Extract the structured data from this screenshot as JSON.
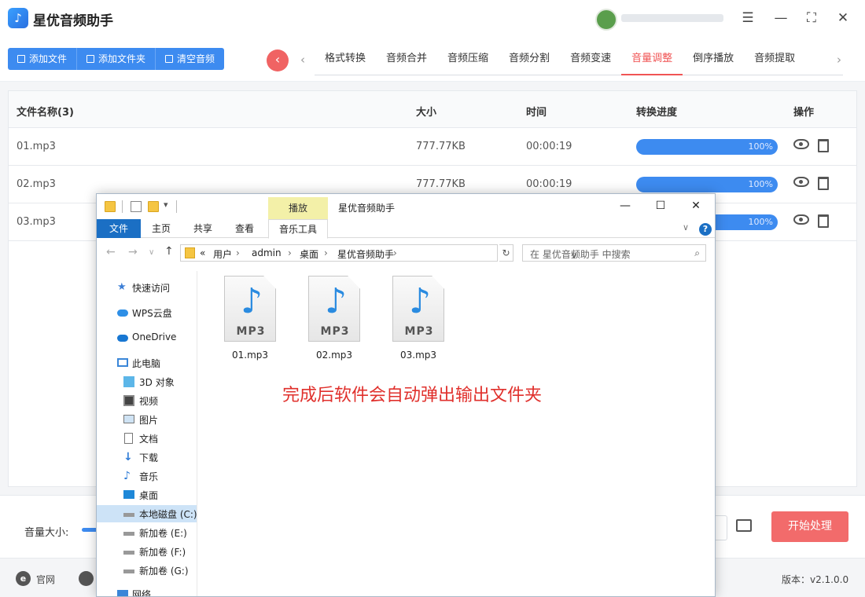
{
  "app": {
    "title": "星优音频助手",
    "logo": "♪"
  },
  "toolbar": {
    "buttons": [
      {
        "label": "添加文件",
        "icon": "file-icon"
      },
      {
        "label": "添加文件夹",
        "icon": "folder-icon"
      },
      {
        "label": "清空音频",
        "icon": "trash-icon"
      }
    ],
    "back_glyph": "‹",
    "tabs": [
      "格式转换",
      "音频合并",
      "音频压缩",
      "音频分割",
      "音频变速",
      "音量调整",
      "倒序播放",
      "音频提取"
    ],
    "active_tab": "音量调整"
  },
  "table": {
    "headers": {
      "name": "文件名称(3)",
      "size": "大小",
      "time": "时间",
      "progress": "转换进度",
      "action": "操作"
    },
    "rows": [
      {
        "name": "01.mp3",
        "size": "777.77KB",
        "time": "00:00:19",
        "progress": "100%"
      },
      {
        "name": "02.mp3",
        "size": "777.77KB",
        "time": "00:00:19",
        "progress": "100%"
      },
      {
        "name": "03.mp3",
        "size": "",
        "time": "",
        "progress": "100%"
      }
    ]
  },
  "bottom": {
    "volume_label": "音量大小:",
    "start_button": "开始处理"
  },
  "footer": {
    "site_label": "官网",
    "version": "版本：v2.1.0.0"
  },
  "explorer": {
    "title": "星优音频助手",
    "play_tab": "播放",
    "ribbon_tabs": {
      "file": "文件",
      "home": "主页",
      "share": "共享",
      "view": "查看",
      "music_tools": "音乐工具"
    },
    "address": [
      "«",
      "用户",
      "admin",
      "桌面",
      "星优音频助手"
    ],
    "search_placeholder": "在 星优音频助手 中搜索",
    "sidebar": [
      {
        "label": "快速访问",
        "icon": "star-icon"
      },
      {
        "label": "WPS云盘",
        "icon": "cloud-icon"
      },
      {
        "label": "OneDrive",
        "icon": "cloud-icon"
      },
      {
        "label": "此电脑",
        "icon": "computer-icon"
      },
      {
        "label": "3D 对象",
        "icon": "cube-icon"
      },
      {
        "label": "视频",
        "icon": "film-icon"
      },
      {
        "label": "图片",
        "icon": "image-icon"
      },
      {
        "label": "文档",
        "icon": "document-icon"
      },
      {
        "label": "下载",
        "icon": "download-icon"
      },
      {
        "label": "音乐",
        "icon": "music-icon"
      },
      {
        "label": "桌面",
        "icon": "desktop-icon"
      },
      {
        "label": "本地磁盘 (C:)",
        "icon": "drive-icon"
      },
      {
        "label": "新加卷 (E:)",
        "icon": "drive-icon"
      },
      {
        "label": "新加卷 (F:)",
        "icon": "drive-icon"
      },
      {
        "label": "新加卷 (G:)",
        "icon": "drive-icon"
      },
      {
        "label": "网络",
        "icon": "network-icon"
      }
    ],
    "selected_sidebar": "本地磁盘 (C:)",
    "file_type_label": "MP3",
    "files": [
      "01.mp3",
      "02.mp3",
      "03.mp3"
    ],
    "annotation": "完成后软件会自动弹出输出文件夹"
  },
  "colors": {
    "primary": "#3d8bf0",
    "accent": "#f05454",
    "start_button": "#f26b6b"
  }
}
